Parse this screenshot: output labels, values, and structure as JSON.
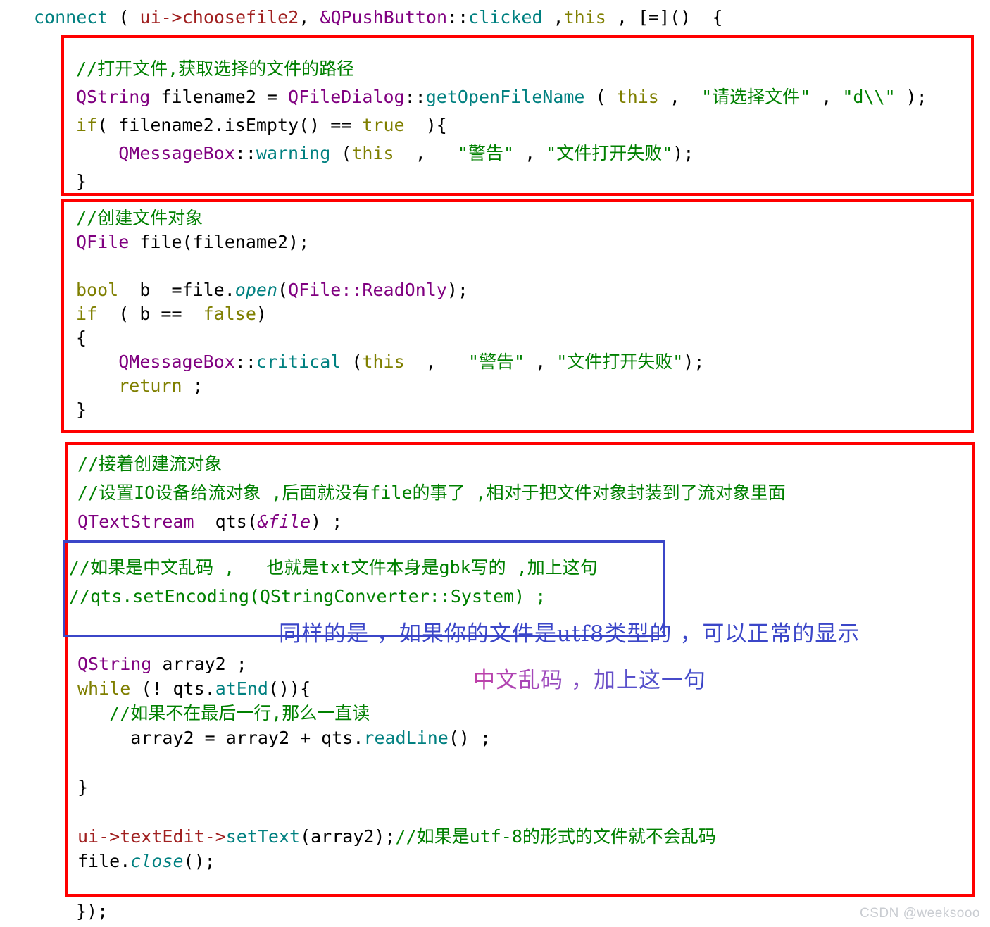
{
  "document": {
    "kind": "annotated-source-code-screenshot",
    "language": "C++ / Qt",
    "watermark": "CSDN @weeksooo",
    "colors": {
      "keyword": "#7f7f00",
      "type": "#800080",
      "function": "#008080",
      "string": "#008000",
      "comment": "#008000",
      "member": "#a02020",
      "plain": "#000000",
      "box_red": "#ff0000",
      "box_blue": "#3b46c8",
      "note_blue": "#3b46c8",
      "watermark": "#c9ccd1",
      "background": "#ffffff"
    }
  },
  "code": {
    "line_connect": "connect ( ui->choosefile2, &QPushButton::clicked ,this , [=]()  {",
    "line_close_lambda": "});",
    "block1": [
      "//打开文件,获取选择的文件的路径",
      "QString filename2 = QFileDialog::getOpenFileName ( this ,  \"请选择文件\" , \"d\\\\\" );",
      "if( filename2.isEmpty() == true  ){",
      "    QMessageBox::warning (this  ,   \"警告\" , \"文件打开失败\");",
      "}"
    ],
    "block2": [
      "//创建文件对象",
      "QFile file(filename2);",
      "",
      "bool  b  =file.open(QFile::ReadOnly);",
      "if  ( b ==  false)",
      "{",
      "    QMessageBox::critical (this  ,   \"警告\" , \"文件打开失败\");",
      "    return ;",
      "}"
    ],
    "block3_head": [
      "//接着创建流对象",
      "//设置IO设备给流对象 ,后面就没有file的事了 ,相对于把文件对象封装到了流对象里面",
      "QTextStream  qts(&file) ;"
    ],
    "block3_blue": [
      "//如果是中文乱码 ,   也就是txt文件本身是gbk写的 ,加上这句",
      "//qts.setEncoding(QStringConverter::System) ;"
    ],
    "block3_tail": [
      "QString array2 ;",
      "while (! qts.atEnd()){",
      "    //如果不在最后一行,那么一直读",
      "     array2 = array2 + qts.readLine() ;",
      "",
      "}",
      "",
      "ui->textEdit->setText(array2);//如果是utf-8的形式的文件就不会乱码",
      "file.close();"
    ]
  },
  "annotations": {
    "note_utf8": "同样的是 ，如果你的文件是utf8类型的 ，可以正常的显示",
    "note_garbled": "中文乱码 ，加上这一句"
  }
}
